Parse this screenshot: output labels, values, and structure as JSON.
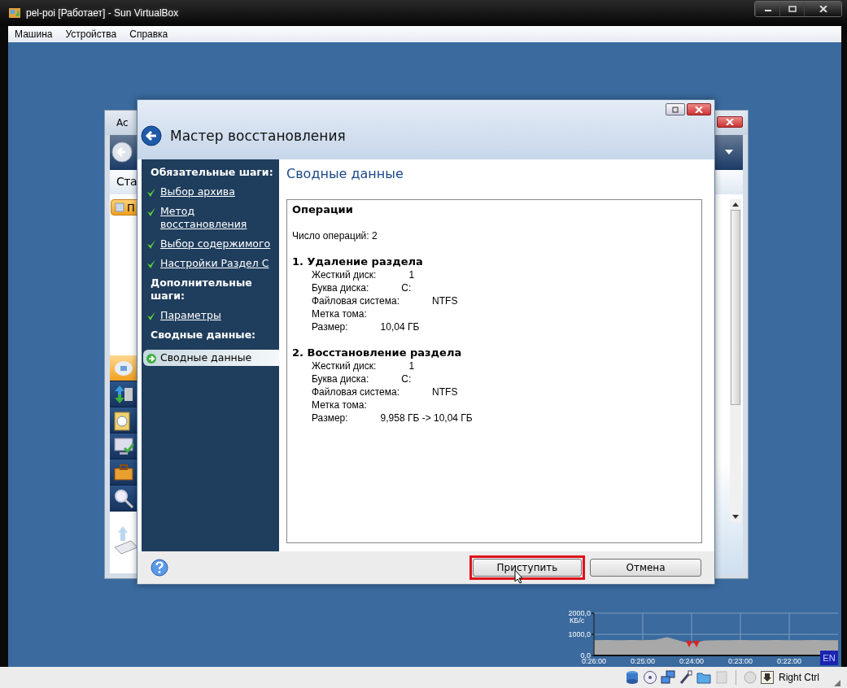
{
  "window": {
    "title": "pel-poi [Работает] - Sun VirtualBox"
  },
  "menu": [
    {
      "label": "Машина"
    },
    {
      "label": "Устройства"
    },
    {
      "label": "Справка"
    }
  ],
  "background_window": {
    "title": "Ac",
    "tab": "Ста",
    "button": "П"
  },
  "dialog": {
    "title": "Мастер восстановления",
    "steps": [
      {
        "kind": "heading",
        "label": "Обязательные шаги:"
      },
      {
        "kind": "step",
        "label": "Выбор архива",
        "done": true,
        "selected": false
      },
      {
        "kind": "step",
        "label": "Метод восстановления",
        "done": true,
        "selected": false
      },
      {
        "kind": "step",
        "label": "Выбор содержимого",
        "done": true,
        "selected": false
      },
      {
        "kind": "step",
        "label": "Настройки Раздел C",
        "done": true,
        "selected": false
      },
      {
        "kind": "heading",
        "label": "Дополнительные шаги:"
      },
      {
        "kind": "step",
        "label": "Параметры",
        "done": true,
        "selected": false
      },
      {
        "kind": "heading",
        "label": "Сводные данные:"
      },
      {
        "kind": "step",
        "label": "Сводные данные",
        "done": false,
        "selected": true
      }
    ],
    "heading": "Сводные данные",
    "summary": {
      "title": "Операции",
      "count": "Число операций: 2",
      "operations": [
        {
          "title": "1. Удаление раздела",
          "rows": [
            {
              "label": "Жесткий диск:",
              "value": "1"
            },
            {
              "label": "Буква диска:",
              "value": "C:"
            },
            {
              "label": "Файловая система:",
              "value": "NTFS"
            },
            {
              "label": "Метка тома:"
            },
            {
              "label": "Размер:",
              "value": "10,04 ГБ"
            }
          ]
        },
        {
          "title": "2. Восстановление раздела",
          "rows": [
            {
              "label": "Жесткий диск:",
              "value": "1"
            },
            {
              "label": "Буква диска:",
              "value": "C:"
            },
            {
              "label": "Файловая система:",
              "value": "NTFS"
            },
            {
              "label": "Метка тома:"
            },
            {
              "label": "Размер:",
              "value": "9,958 ГБ -> 10,04 ГБ"
            }
          ]
        }
      ]
    },
    "buttons": [
      {
        "label": "Приступить",
        "highlighted": true
      },
      {
        "label": "Отмена",
        "highlighted": false
      }
    ]
  },
  "network_chart": {
    "chart_data": {
      "type": "area",
      "ylabel": "КБ/с",
      "categories": [
        "0:26:00",
        null,
        null,
        null,
        "0:25:00",
        null,
        null,
        null,
        "0:24:00",
        null,
        null,
        null,
        "0:23:00",
        null,
        null,
        null,
        "0:22:00",
        null,
        null,
        null,
        null
      ],
      "values": [
        720,
        730,
        720,
        730,
        720,
        740,
        860,
        700,
        560,
        700,
        720,
        720,
        730,
        720,
        720,
        730,
        720,
        720,
        730,
        720,
        720
      ],
      "ylim": [
        0,
        2000
      ],
      "grid": true,
      "yticks": [
        {
          "value": 0,
          "label": "0,0"
        },
        {
          "value": 1000,
          "label": "1000,0"
        },
        {
          "value": 2000,
          "label": "2000,0"
        }
      ]
    }
  },
  "language": "EN",
  "status_bar": {
    "host_key": "Right Ctrl"
  }
}
